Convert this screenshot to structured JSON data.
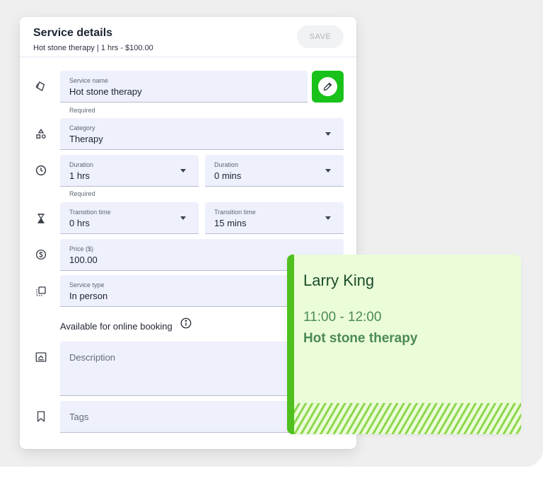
{
  "header": {
    "title": "Service details",
    "subtitle_part1": "Hot stone therapy | ",
    "subtitle_part2": "1 hrs - $100.00",
    "save_label": "SAVE"
  },
  "form": {
    "service_name": {
      "label": "Service name",
      "value": "Hot stone therapy",
      "helper": "Required"
    },
    "category": {
      "label": "Category",
      "value": "Therapy"
    },
    "duration_hours": {
      "label": "Duration",
      "value": "1 hrs",
      "helper": "Required"
    },
    "duration_minutes": {
      "label": "Duration",
      "value": "0 mins"
    },
    "transition_hours": {
      "label": "Transition time",
      "value": "0 hrs"
    },
    "transition_minutes": {
      "label": "Transition time",
      "value": "15 mins"
    },
    "price": {
      "label": "Price ($)",
      "value": "100.00"
    },
    "service_type": {
      "label": "Service type",
      "value": "In person"
    },
    "online_booking_label": "Available for online booking",
    "description_placeholder": "Description",
    "tags_placeholder": "Tags"
  },
  "appointment": {
    "client_name": "Larry King",
    "time": "11:00 - 12:00",
    "service": "Hot stone therapy"
  },
  "colors": {
    "accent_green": "#18c21a",
    "field_bg": "#eef0fc",
    "appointment_bg": "#eafcd8",
    "appointment_bar": "#4fc01e"
  },
  "icons": [
    "tag-icon",
    "shapes-icon",
    "clock-icon",
    "hourglass-icon",
    "dollar-icon",
    "service-type-icon",
    "description-icon",
    "bookmark-icon",
    "pencil-icon",
    "info-icon"
  ]
}
